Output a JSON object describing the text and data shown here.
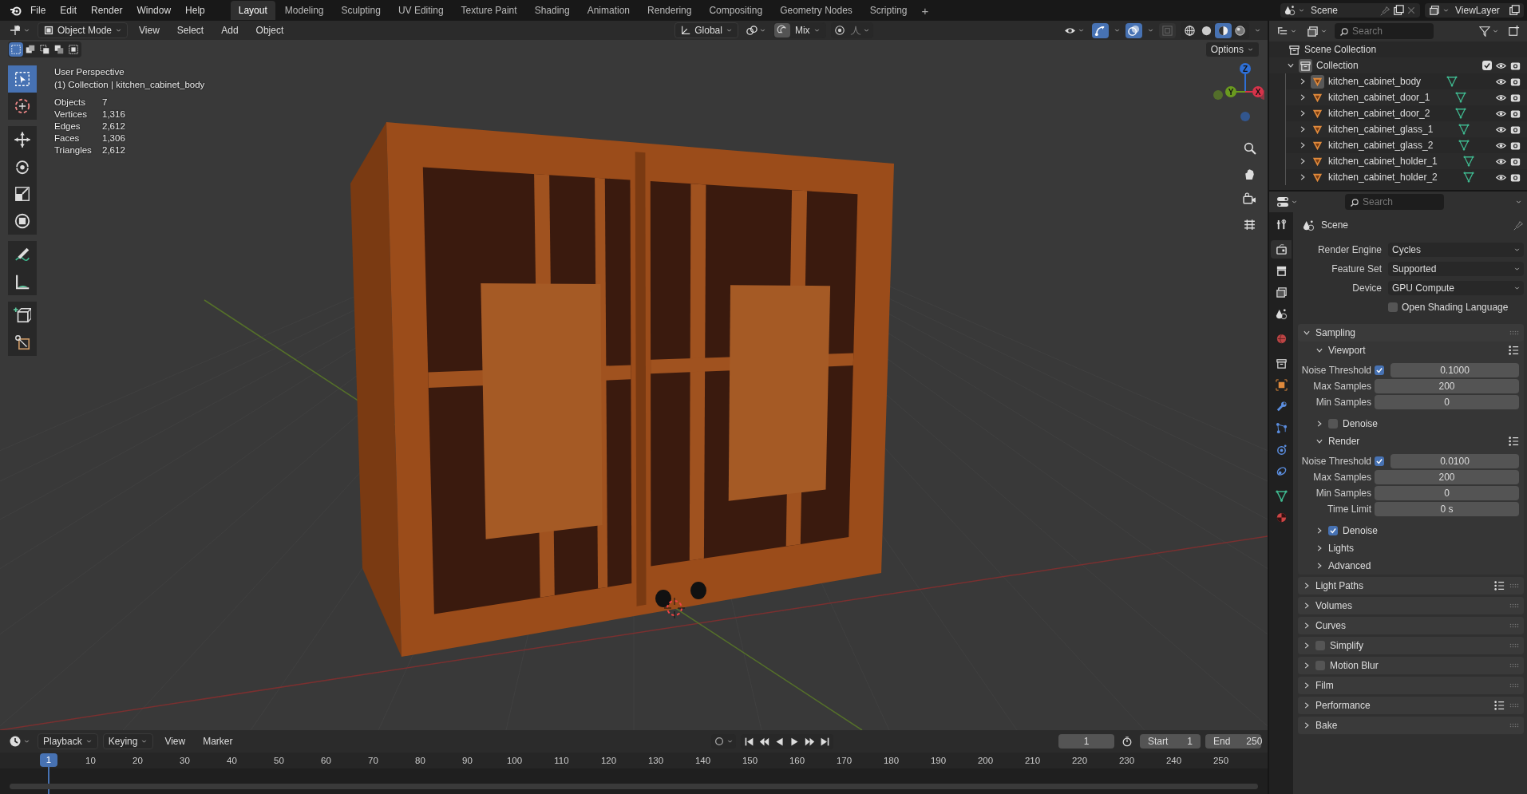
{
  "menu": [
    "File",
    "Edit",
    "Render",
    "Window",
    "Help"
  ],
  "workspaces": [
    {
      "label": "Layout",
      "selected": true
    },
    {
      "label": "Modeling",
      "selected": false
    },
    {
      "label": "Sculpting",
      "selected": false
    },
    {
      "label": "UV Editing",
      "selected": false
    },
    {
      "label": "Texture Paint",
      "selected": false
    },
    {
      "label": "Shading",
      "selected": false
    },
    {
      "label": "Animation",
      "selected": false
    },
    {
      "label": "Rendering",
      "selected": false
    },
    {
      "label": "Compositing",
      "selected": false
    },
    {
      "label": "Geometry Nodes",
      "selected": false
    },
    {
      "label": "Scripting",
      "selected": false
    }
  ],
  "add_workspace": "+",
  "scene": "Scene",
  "view_layer": "ViewLayer",
  "viewport": {
    "mode": "Object Mode",
    "menus": [
      "View",
      "Select",
      "Add",
      "Object"
    ],
    "orientation": "Global",
    "snap_target": "Mix",
    "options": "Options",
    "gizmos_on": true,
    "overlays_on": true,
    "xray_on": false,
    "shading_modes": [
      {
        "selected": false
      },
      {
        "selected": false
      },
      {
        "selected": true
      },
      {
        "selected": false
      }
    ],
    "select_modes": [
      {
        "selected": true
      },
      {
        "selected": false
      },
      {
        "selected": false
      },
      {
        "selected": false
      },
      {
        "selected": false
      }
    ],
    "tools": [
      {
        "selected": true
      },
      {
        "selected": false
      },
      {
        "selected": false
      },
      {
        "selected": false
      },
      {
        "selected": false
      },
      {
        "selected": false
      },
      {
        "selected": false
      },
      {
        "selected": false
      },
      {
        "selected": false
      },
      {
        "selected": false
      }
    ],
    "view_name": "User Perspective",
    "context": "(1) Collection | kitchen_cabinet_body",
    "stats": [
      {
        "label": "Objects",
        "value": "7"
      },
      {
        "label": "Vertices",
        "value": "1,316"
      },
      {
        "label": "Edges",
        "value": "2,612"
      },
      {
        "label": "Faces",
        "value": "1,306"
      },
      {
        "label": "Triangles",
        "value": "2,612"
      }
    ],
    "gizmo_axes": [
      "Z",
      "Y",
      "X"
    ]
  },
  "outliner": {
    "search_placeholder": "Search",
    "root": "Scene Collection",
    "collection": {
      "name": "Collection",
      "expanded": true,
      "checked": true,
      "children": [
        {
          "name": "kitchen_cabinet_body",
          "selected": true
        },
        {
          "name": "kitchen_cabinet_door_1",
          "selected": false
        },
        {
          "name": "kitchen_cabinet_door_2",
          "selected": false
        },
        {
          "name": "kitchen_cabinet_glass_1",
          "selected": false
        },
        {
          "name": "kitchen_cabinet_glass_2",
          "selected": false
        },
        {
          "name": "kitchen_cabinet_holder_1",
          "selected": false
        },
        {
          "name": "kitchen_cabinet_holder_2",
          "selected": false
        }
      ]
    }
  },
  "properties": {
    "search_placeholder": "Search",
    "context": "Scene",
    "tabs": [
      {
        "selected": false
      },
      {
        "selected": true
      },
      {
        "selected": false
      },
      {
        "selected": false
      },
      {
        "selected": false
      },
      {
        "selected": false
      },
      {
        "selected": false
      },
      {
        "selected": false
      },
      {
        "selected": false
      },
      {
        "selected": false
      },
      {
        "selected": false
      },
      {
        "selected": false
      },
      {
        "selected": false
      },
      {
        "selected": false
      }
    ],
    "fields": [
      {
        "kind": "dropdown",
        "label": "Render Engine",
        "value": "Cycles"
      },
      {
        "kind": "dropdown",
        "label": "Feature Set",
        "value": "Supported"
      },
      {
        "kind": "dropdown",
        "label": "Device",
        "value": "GPU Compute"
      },
      {
        "kind": "checkbox",
        "label": "Open Shading Language",
        "checked": false
      }
    ],
    "panels": [
      {
        "kind": "section",
        "title": "Sampling",
        "expanded": true,
        "presets": false,
        "children": [
          {
            "kind": "section",
            "title": "Viewport",
            "expanded": true,
            "presets": true,
            "rows": [
              {
                "kind": "check-number",
                "label": "Noise Threshold",
                "checked": true,
                "value": "0.1000"
              },
              {
                "kind": "number",
                "label": "Max Samples",
                "value": "200"
              },
              {
                "kind": "number",
                "label": "Min Samples",
                "value": "0"
              }
            ]
          },
          {
            "kind": "check-section",
            "title": "Denoise",
            "checked": false,
            "expanded": false,
            "presets": false
          },
          {
            "kind": "section",
            "title": "Render",
            "expanded": true,
            "presets": true,
            "rows": [
              {
                "kind": "check-number",
                "label": "Noise Threshold",
                "checked": true,
                "value": "0.0100"
              },
              {
                "kind": "number",
                "label": "Max Samples",
                "value": "200"
              },
              {
                "kind": "number",
                "label": "Min Samples",
                "value": "0"
              },
              {
                "kind": "number",
                "label": "Time Limit",
                "value": "0 s"
              }
            ]
          },
          {
            "kind": "check-section",
            "title": "Denoise",
            "checked": true,
            "expanded": false,
            "presets": false
          },
          {
            "kind": "section",
            "title": "Lights",
            "expanded": false,
            "presets": false
          },
          {
            "kind": "section",
            "title": "Advanced",
            "expanded": false,
            "presets": false
          }
        ]
      },
      {
        "kind": "section",
        "title": "Light Paths",
        "expanded": false,
        "presets": true
      },
      {
        "kind": "section",
        "title": "Volumes",
        "expanded": false,
        "presets": false
      },
      {
        "kind": "section",
        "title": "Curves",
        "expanded": false,
        "presets": false
      },
      {
        "kind": "check-section",
        "title": "Simplify",
        "checked": false,
        "expanded": false,
        "presets": false
      },
      {
        "kind": "check-section",
        "title": "Motion Blur",
        "checked": false,
        "expanded": false,
        "presets": false
      },
      {
        "kind": "section",
        "title": "Film",
        "expanded": false,
        "presets": false
      },
      {
        "kind": "section",
        "title": "Performance",
        "expanded": false,
        "presets": true
      },
      {
        "kind": "section",
        "title": "Bake",
        "expanded": false,
        "presets": false
      }
    ]
  },
  "timeline": {
    "menus": [
      "Playback",
      "Keying",
      "View",
      "Marker"
    ],
    "current_frame": "1",
    "start_label": "Start",
    "start": "1",
    "end_label": "End",
    "end": "250",
    "playhead": "1",
    "ticks": [
      "10",
      "20",
      "30",
      "40",
      "50",
      "60",
      "70",
      "80",
      "90",
      "100",
      "110",
      "120",
      "130",
      "140",
      "150",
      "160",
      "170",
      "180",
      "190",
      "200",
      "210",
      "220",
      "230",
      "240",
      "250"
    ]
  }
}
